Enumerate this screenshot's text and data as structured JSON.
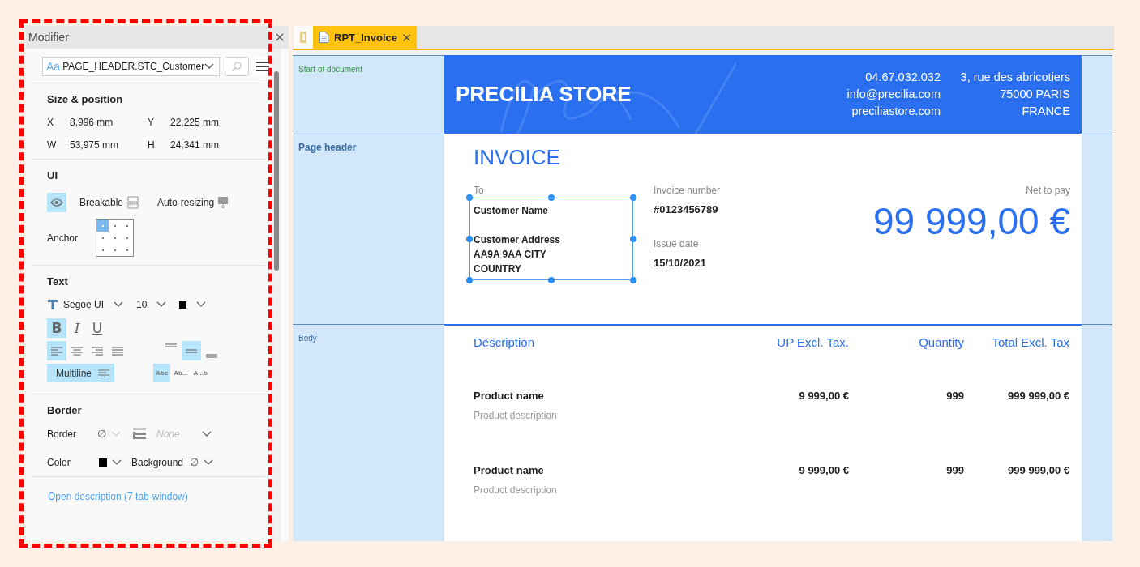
{
  "panel": {
    "title": "Modifier",
    "object_field": {
      "prefix": "Aa",
      "value": "PAGE_HEADER.STC_Customer"
    },
    "size_position": {
      "heading": "Size & position",
      "fields": [
        {
          "label": "X",
          "value": "8,996 mm"
        },
        {
          "label": "Y",
          "value": "22,225 mm"
        },
        {
          "label": "W",
          "value": "53,975 mm"
        },
        {
          "label": "H",
          "value": "24,341 mm"
        }
      ]
    },
    "ui": {
      "heading": "UI",
      "visible": {
        "selected": true
      },
      "breakable": "Breakable",
      "auto_resizing": "Auto-resizing",
      "anchor_label": "Anchor",
      "anchor_cells": [
        {
          "selected": true
        },
        {
          "selected": false
        },
        {
          "selected": false
        },
        {
          "selected": false
        },
        {
          "selected": false
        },
        {
          "selected": false
        },
        {
          "selected": false
        },
        {
          "selected": false
        },
        {
          "selected": false
        }
      ]
    },
    "text": {
      "heading": "Text",
      "font": "Segoe UI",
      "size": "10",
      "color": "#000000",
      "styles": [
        {
          "label": "B",
          "kind": "bold",
          "selected": true
        },
        {
          "label": "I",
          "kind": "italic",
          "selected": false
        },
        {
          "label": "U",
          "kind": "underline",
          "selected": false
        }
      ],
      "h_align": [
        {
          "kind": "left",
          "selected": true
        },
        {
          "kind": "center",
          "selected": false
        },
        {
          "kind": "right",
          "selected": false
        },
        {
          "kind": "justify",
          "selected": false
        }
      ],
      "v_align": [
        {
          "kind": "top",
          "selected": false
        },
        {
          "kind": "middle",
          "selected": true
        },
        {
          "kind": "bottom",
          "selected": false
        }
      ],
      "multiline": {
        "label": "Multiline",
        "selected": true
      },
      "overflow": [
        {
          "label": "Abc",
          "selected": true
        },
        {
          "label": "Ab...",
          "selected": false
        },
        {
          "label": "A...b",
          "selected": false
        }
      ]
    },
    "border": {
      "heading": "Border",
      "border_label": "Border",
      "border_value": "∅",
      "style_value": "None",
      "color_label": "Color",
      "color": "#000000",
      "background_label": "Background",
      "background_value": "∅"
    },
    "link": "Open description (7 tab-window)"
  },
  "tabs": [
    {
      "label": "RPT_Invoice",
      "selected": true
    }
  ],
  "sections": [
    {
      "label": "Start of document",
      "kind": "start"
    },
    {
      "label": "Page header",
      "kind": "header"
    },
    {
      "label": "Body",
      "kind": "body"
    }
  ],
  "document": {
    "store_name": "PRECILIA STORE",
    "contact": [
      "04.67.032.032",
      "info@precilia.com",
      "preciliastore.com"
    ],
    "address": [
      "3, rue des abricotiers",
      "75000 PARIS",
      "FRANCE"
    ],
    "title": "INVOICE",
    "to_label": "To",
    "customer": {
      "selected": true,
      "name": "Customer Name",
      "address_lines": [
        "Customer Address",
        "AA9A 9AA CITY",
        "COUNTRY"
      ]
    },
    "invoice_number_label": "Invoice number",
    "invoice_number": "#0123456789",
    "issue_date_label": "Issue date",
    "issue_date": "15/10/2021",
    "net_label": "Net to pay",
    "net_amount": "99 999,00 €",
    "columns": [
      "Description",
      "UP Excl. Tax.",
      "Quantity",
      "Total Excl. Tax"
    ],
    "rows": [
      {
        "name": "Product name",
        "description": "Product description",
        "unit_price": "9 999,00 €",
        "quantity": "999",
        "total": "999 999,00 €"
      },
      {
        "name": "Product name",
        "description": "Product description",
        "unit_price": "9 999,00 €",
        "quantity": "999",
        "total": "999 999,00 €"
      }
    ]
  }
}
